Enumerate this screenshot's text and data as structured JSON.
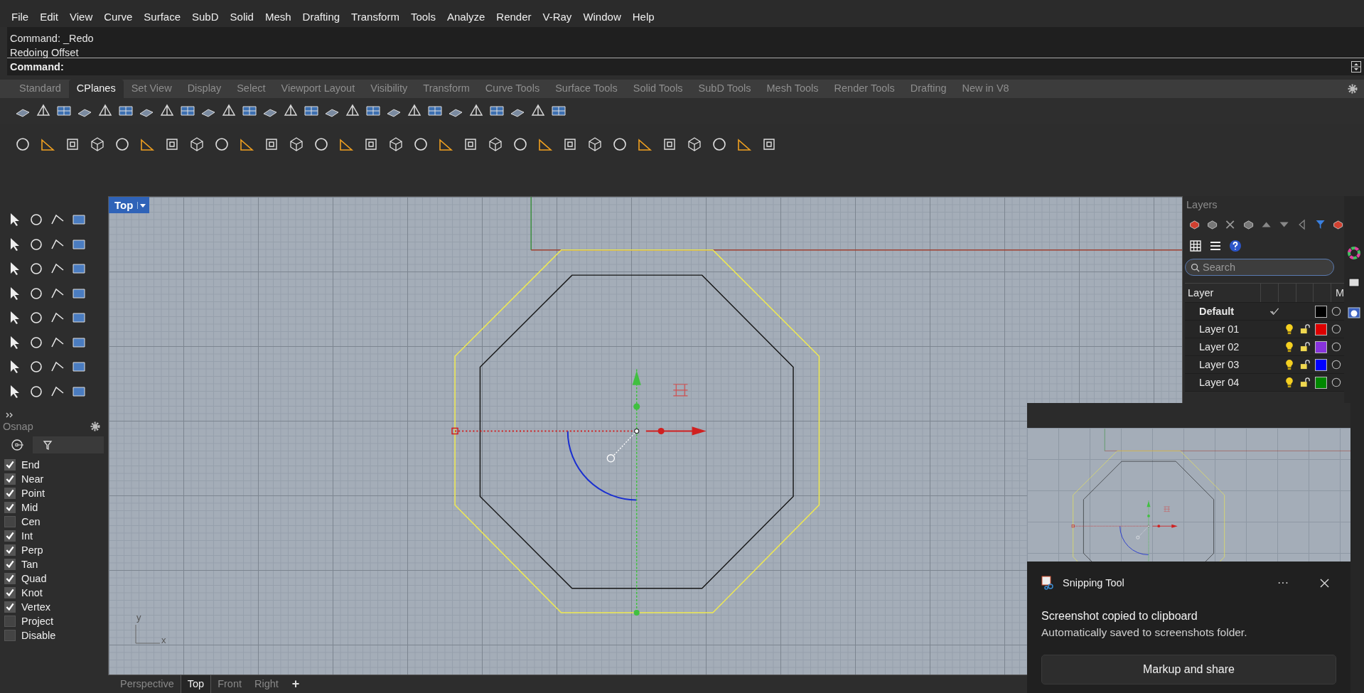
{
  "menu": [
    "File",
    "Edit",
    "View",
    "Curve",
    "Surface",
    "SubD",
    "Solid",
    "Mesh",
    "Drafting",
    "Transform",
    "Tools",
    "Analyze",
    "Render",
    "V-Ray",
    "Window",
    "Help"
  ],
  "command": {
    "history": [
      "Command: _Redo",
      "Redoing Offset"
    ],
    "prompt": "Command:"
  },
  "toolbar_tabs": [
    {
      "label": "Standard",
      "selected": false
    },
    {
      "label": "CPlanes",
      "selected": true
    },
    {
      "label": "Set View",
      "selected": false
    },
    {
      "label": "Display",
      "selected": false
    },
    {
      "label": "Select",
      "selected": false
    },
    {
      "label": "Viewport Layout",
      "selected": false
    },
    {
      "label": "Visibility",
      "selected": false
    },
    {
      "label": "Transform",
      "selected": false
    },
    {
      "label": "Curve Tools",
      "selected": false
    },
    {
      "label": "Surface Tools",
      "selected": false
    },
    {
      "label": "Solid Tools",
      "selected": false
    },
    {
      "label": "SubD Tools",
      "selected": false
    },
    {
      "label": "Mesh Tools",
      "selected": false
    },
    {
      "label": "Render Tools",
      "selected": false
    },
    {
      "label": "Drafting",
      "selected": false
    },
    {
      "label": "New in V8",
      "selected": false
    }
  ],
  "viewport": {
    "title": "Top",
    "axis_y": "y",
    "axis_x": "x"
  },
  "viewport_tabs": [
    {
      "label": "Perspective",
      "selected": false
    },
    {
      "label": "Top",
      "selected": true
    },
    {
      "label": "Front",
      "selected": false
    },
    {
      "label": "Right",
      "selected": false
    }
  ],
  "add_tab": "+",
  "osnap": {
    "title": "Osnap",
    "items": [
      {
        "label": "End",
        "checked": true
      },
      {
        "label": "Near",
        "checked": true
      },
      {
        "label": "Point",
        "checked": true
      },
      {
        "label": "Mid",
        "checked": true
      },
      {
        "label": "Cen",
        "checked": false
      },
      {
        "label": "Int",
        "checked": true
      },
      {
        "label": "Perp",
        "checked": true
      },
      {
        "label": "Tan",
        "checked": true
      },
      {
        "label": "Quad",
        "checked": true
      },
      {
        "label": "Knot",
        "checked": true
      },
      {
        "label": "Vertex",
        "checked": true
      },
      {
        "label": "Project",
        "checked": false
      },
      {
        "label": "Disable",
        "checked": false
      }
    ]
  },
  "layers": {
    "title": "Layers",
    "search_placeholder": "Search",
    "columns": [
      "Layer",
      "M"
    ],
    "rows": [
      {
        "name": "Default",
        "current": true,
        "color": "#000000"
      },
      {
        "name": "Layer 01",
        "current": false,
        "color": "#dd0000"
      },
      {
        "name": "Layer 02",
        "current": false,
        "color": "#8833dd"
      },
      {
        "name": "Layer 03",
        "current": false,
        "color": "#0000ff"
      },
      {
        "name": "Layer 04",
        "current": false,
        "color": "#008800"
      }
    ]
  },
  "notification": {
    "app": "Snipping Tool",
    "more": "···",
    "title": "Screenshot copied to clipboard",
    "body": "Automatically saved to screenshots folder.",
    "button": "Markup and share"
  }
}
